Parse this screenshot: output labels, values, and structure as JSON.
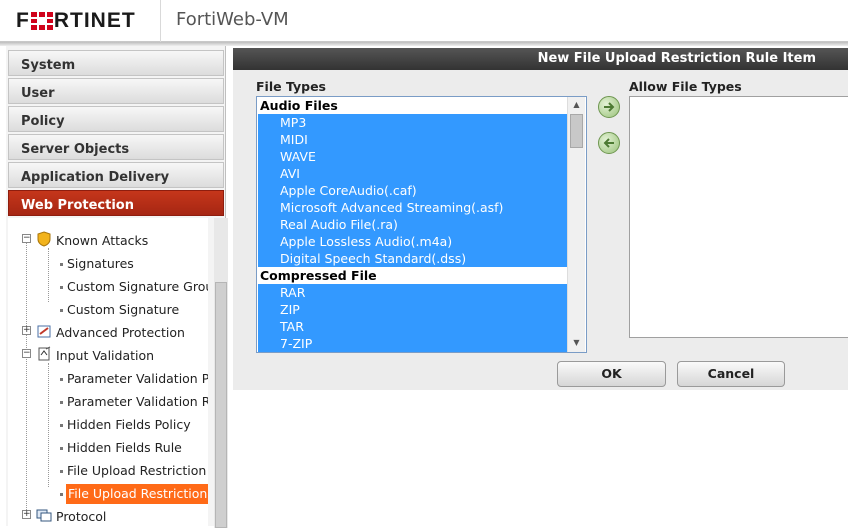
{
  "header": {
    "logo_text_left": "F",
    "logo_text_right": "RTINET",
    "product": "FortiWeb-VM",
    "brand_color": "#d0021b"
  },
  "sidebar": {
    "nav": [
      {
        "label": "System"
      },
      {
        "label": "User"
      },
      {
        "label": "Policy"
      },
      {
        "label": "Server Objects"
      },
      {
        "label": "Application Delivery"
      },
      {
        "label": "Web Protection",
        "active": true
      }
    ],
    "tree": [
      {
        "label": "Known Attacks",
        "icon": "shield-icon",
        "expanded": true
      },
      {
        "label": "Signatures"
      },
      {
        "label": "Custom Signature Grou"
      },
      {
        "label": "Custom Signature"
      },
      {
        "label": "Advanced Protection",
        "icon": "advanced-protection-icon",
        "expanded": false
      },
      {
        "label": "Input Validation",
        "icon": "input-validation-icon",
        "expanded": true
      },
      {
        "label": "Parameter Validation Po"
      },
      {
        "label": "Parameter Validation Ru"
      },
      {
        "label": "Hidden Fields Policy"
      },
      {
        "label": "Hidden Fields Rule"
      },
      {
        "label": "File Upload Restriction P"
      },
      {
        "label": "File Upload Restriction R",
        "selected": true
      },
      {
        "label": "Protocol",
        "icon": "protocol-icon",
        "expanded": false
      }
    ]
  },
  "panel": {
    "title": "New File Upload Restriction Rule Item",
    "file_types_label": "File Types",
    "allow_label": "Allow File Types",
    "file_types": [
      {
        "group": "Audio Files"
      },
      {
        "option": "MP3"
      },
      {
        "option": "MIDI"
      },
      {
        "option": "WAVE"
      },
      {
        "option": "AVI"
      },
      {
        "option": "Apple CoreAudio(.caf)"
      },
      {
        "option": "Microsoft Advanced Streaming(.asf)"
      },
      {
        "option": "Real Audio File(.ra)"
      },
      {
        "option": "Apple Lossless Audio(.m4a)"
      },
      {
        "option": "Digital Speech Standard(.dss)"
      },
      {
        "group": "Compressed File"
      },
      {
        "option": "RAR"
      },
      {
        "option": "ZIP"
      },
      {
        "option": "TAR"
      },
      {
        "option": "7-ZIP"
      }
    ],
    "allow_file_types": [],
    "ok_label": "OK",
    "cancel_label": "Cancel",
    "selection_color": "#3399ff",
    "move_icons": [
      "arrow-right-icon",
      "arrow-left-icon"
    ]
  }
}
